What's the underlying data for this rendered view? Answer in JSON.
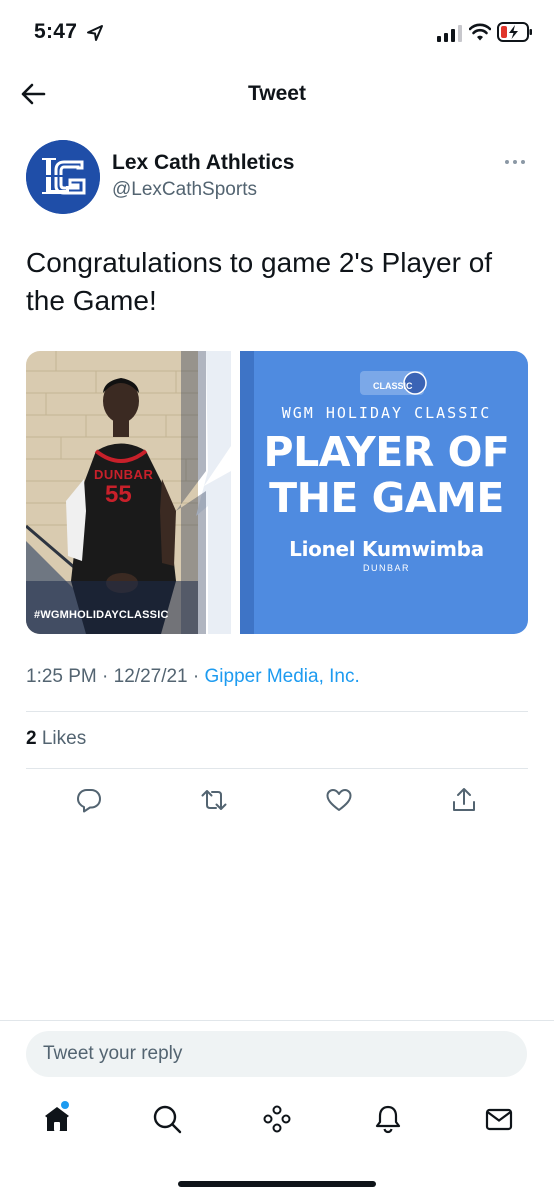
{
  "status_bar": {
    "time": "5:47",
    "icons": [
      "location-arrow-icon",
      "signal-icon",
      "wifi-icon",
      "battery-charging-icon"
    ]
  },
  "header": {
    "title": "Tweet",
    "back_icon": "back-arrow-icon"
  },
  "author": {
    "name": "Lex Cath Athletics",
    "handle": "@LexCathSports",
    "avatar_icon": "lc-logo-avatar",
    "more_icon": "more-dots-icon"
  },
  "tweet": {
    "text": "Congratulations to game 2's Player of the Game!"
  },
  "media": {
    "hashtag": "#WGMHOLIDAYCLASSIC",
    "logo_text": "CLASSIC",
    "eyebrow": "WGM HOLIDAY CLASSIC",
    "headline_line1": "PLAYER OF",
    "headline_line2": "THE GAME",
    "player_name": "Lionel Kumwimba",
    "school": "DUNBAR",
    "jersey_text": "DUNBAR",
    "jersey_number": "55",
    "colors": {
      "panel": "#4f8be0",
      "jersey": "#1a1a1a",
      "jersey_text": "#c8202a"
    }
  },
  "meta": {
    "time": "1:25 PM",
    "date": "12/27/21",
    "separator": "·",
    "source": "Gipper Media, Inc."
  },
  "likes": {
    "count": "2",
    "label": "Likes"
  },
  "actions": [
    "reply-icon",
    "retweet-icon",
    "like-icon",
    "share-icon"
  ],
  "reply": {
    "placeholder": "Tweet your reply"
  },
  "tabs": [
    "home-icon",
    "search-icon",
    "spaces-icon",
    "notifications-icon",
    "messages-icon"
  ],
  "colors": {
    "accent": "#1d9bf0",
    "text": "#0f1419",
    "secondary": "#536471"
  }
}
